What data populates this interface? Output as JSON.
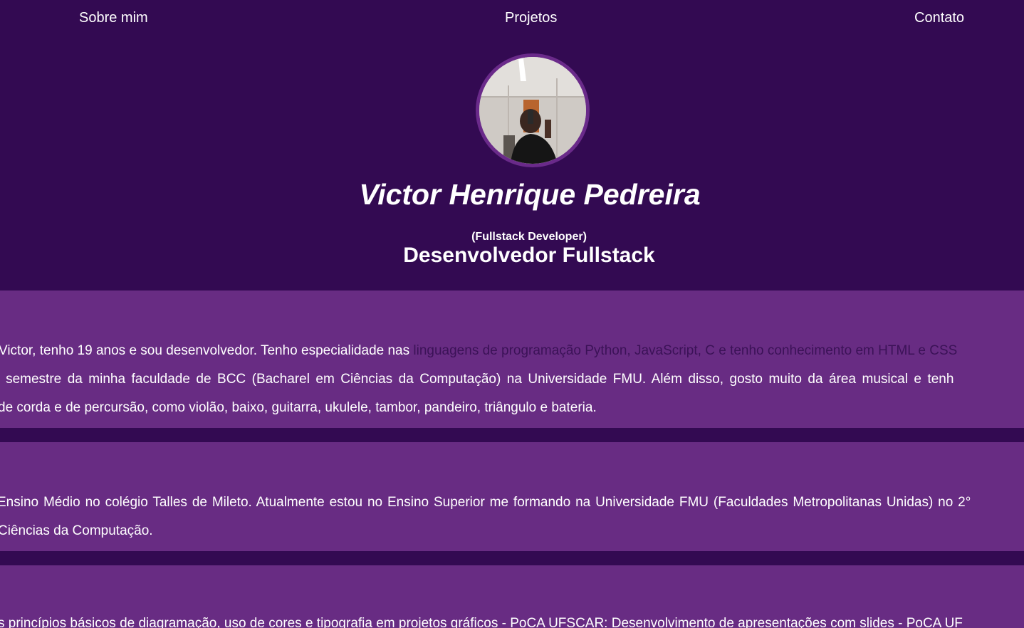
{
  "nav": {
    "about": "Sobre mim",
    "projects": "Projetos",
    "contact": "Contato"
  },
  "hero": {
    "name": "Victor Henrique Pedreira",
    "role_en": "(Fullstack Developer)",
    "role_pt": "Desenvolvedor Fullstack"
  },
  "about": {
    "line1_a": "Victor, tenho 19 anos e sou desenvolvedor. Tenho especialidade nas ",
    "line1_b": "linguagens de programação Python, JavaScript, C e tenho conhecimento em HTML e CSS",
    "line2": "° semestre da minha faculdade de BCC (Bacharel em Ciências da Computação) na Universidade FMU. Além disso, gosto muito da área musical e tenh",
    "line3": "de corda e de percursão, como violão, baixo, guitarra, ukulele, tambor, pandeiro, triângulo e bateria."
  },
  "education": {
    "line1": "Ensino Médio no colégio Talles de Mileto. Atualmente estou no Ensino Superior me formando na Universidade FMU (Faculdades Metropolitanas Unidas) no 2°",
    "line2": "Ciências da Computação."
  },
  "courses": {
    "line1": "s princípios básicos de diagramação, uso de cores e tipografia em projetos gráficos - PoCA UFSCAR: Desenvolvimento de apresentações com slides - PoCA UF"
  },
  "colors": {
    "background": "#330a52",
    "section": "#682c83",
    "highlight_text": "#3b1257",
    "avatar_border": "#6a2a8a"
  }
}
